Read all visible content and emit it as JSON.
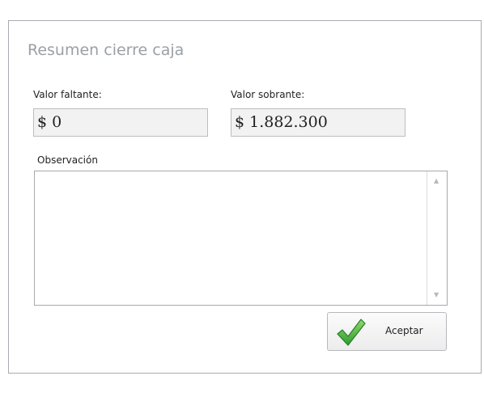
{
  "dialog": {
    "title": "Resumen cierre caja",
    "faltante_label": "Valor faltante:",
    "faltante_value": "$ 0",
    "sobrante_label": "Valor sobrante:",
    "sobrante_value": "$ 1.882.300",
    "observacion_label": "Observación",
    "observacion_value": "",
    "accept_button_label": "Aceptar",
    "accept_icon": "checkmark-icon",
    "colors": {
      "title": "#9aa0a6",
      "readout_bg": "#f2f2f2",
      "check_green": "#3caa3c"
    }
  }
}
